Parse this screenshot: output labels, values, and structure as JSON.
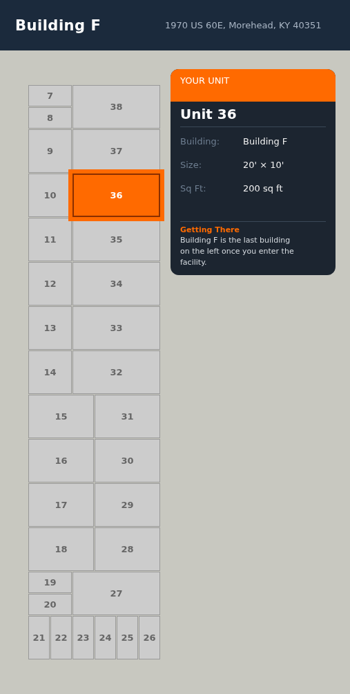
{
  "header": {
    "title": "Building F",
    "address": "1970 US 60E, Morehead, KY 40351"
  },
  "units": [
    {
      "number": "7",
      "selected": false
    },
    {
      "number": "8",
      "selected": false
    },
    {
      "number": "38",
      "selected": false
    },
    {
      "number": "9",
      "selected": false
    },
    {
      "number": "37",
      "selected": false
    },
    {
      "number": "10",
      "selected": false
    },
    {
      "number": "36",
      "selected": true
    },
    {
      "number": "11",
      "selected": false
    },
    {
      "number": "35",
      "selected": false
    },
    {
      "number": "12",
      "selected": false
    },
    {
      "number": "34",
      "selected": false
    },
    {
      "number": "13",
      "selected": false
    },
    {
      "number": "33",
      "selected": false
    },
    {
      "number": "14",
      "selected": false
    },
    {
      "number": "32",
      "selected": false
    },
    {
      "number": "15",
      "selected": false
    },
    {
      "number": "31",
      "selected": false
    },
    {
      "number": "16",
      "selected": false
    },
    {
      "number": "30",
      "selected": false
    },
    {
      "number": "17",
      "selected": false
    },
    {
      "number": "29",
      "selected": false
    },
    {
      "number": "18",
      "selected": false
    },
    {
      "number": "28",
      "selected": false
    },
    {
      "number": "19",
      "selected": false
    },
    {
      "number": "20",
      "selected": false
    },
    {
      "number": "27",
      "selected": false
    },
    {
      "number": "21",
      "selected": false
    },
    {
      "number": "22",
      "selected": false
    },
    {
      "number": "23",
      "selected": false
    },
    {
      "number": "24",
      "selected": false
    },
    {
      "number": "25",
      "selected": false
    },
    {
      "number": "26",
      "selected": false
    }
  ],
  "card": {
    "label": "YOUR UNIT",
    "title": "Unit 36",
    "details": [
      {
        "label": "Building:",
        "value": "Building F"
      },
      {
        "label": "Size:",
        "value": "20' × 10'"
      },
      {
        "label": "Sq Ft:",
        "value": "200 sq ft"
      }
    ],
    "directions_title": "Getting There",
    "directions": "Building F is the last building on the left once you enter the facility."
  }
}
